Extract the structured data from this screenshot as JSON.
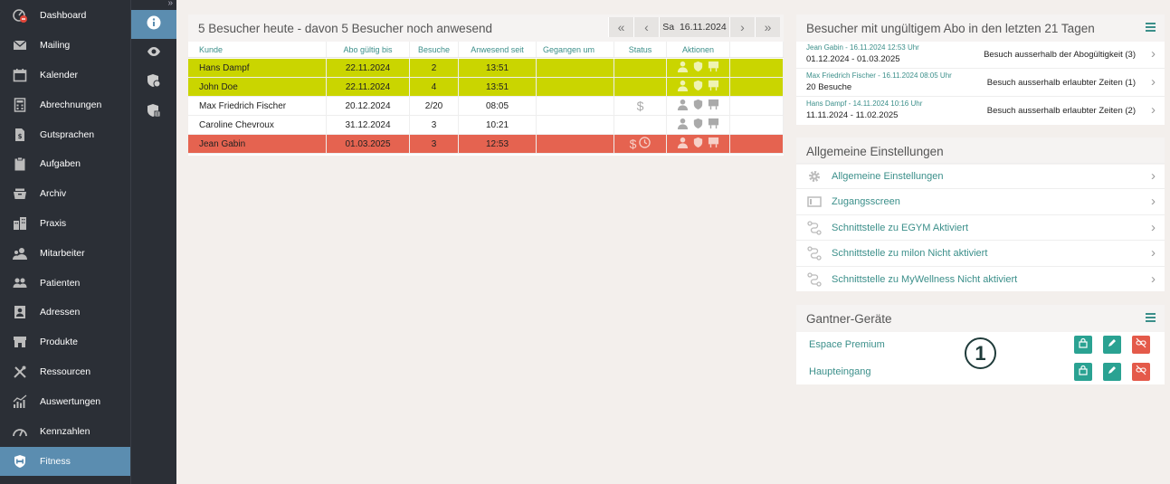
{
  "sidebar": {
    "items": [
      {
        "label": "Dashboard",
        "icon": "dashboard-icon"
      },
      {
        "label": "Mailing",
        "icon": "mail-icon"
      },
      {
        "label": "Kalender",
        "icon": "calendar-icon"
      },
      {
        "label": "Abrechnungen",
        "icon": "calculator-icon"
      },
      {
        "label": "Gutsprachen",
        "icon": "document-icon"
      },
      {
        "label": "Aufgaben",
        "icon": "clipboard-icon"
      },
      {
        "label": "Archiv",
        "icon": "archive-icon"
      },
      {
        "label": "Praxis",
        "icon": "building-icon"
      },
      {
        "label": "Mitarbeiter",
        "icon": "staff-icon"
      },
      {
        "label": "Patienten",
        "icon": "patients-icon"
      },
      {
        "label": "Adressen",
        "icon": "address-book-icon"
      },
      {
        "label": "Produkte",
        "icon": "shop-icon"
      },
      {
        "label": "Ressourcen",
        "icon": "tools-icon"
      },
      {
        "label": "Auswertungen",
        "icon": "chart-icon"
      },
      {
        "label": "Kennzahlen",
        "icon": "gauge-icon"
      },
      {
        "label": "Fitness",
        "icon": "fitness-icon"
      }
    ],
    "active": "Fitness"
  },
  "iconbar": {
    "expand": "»",
    "items": [
      "info-icon",
      "eye-icon",
      "shield-icon",
      "shield-list-icon"
    ]
  },
  "visitors": {
    "title": "5 Besucher heute - davon 5 Besucher noch anwesend",
    "date_day": "Sa",
    "date": "16.11.2024",
    "nav": {
      "first": "«",
      "prev": "‹",
      "next": "›",
      "last": "»"
    },
    "columns": [
      "Kunde",
      "Abo gültig bis",
      "Besuche",
      "Anwesend seit",
      "Gegangen um",
      "Status",
      "Aktionen"
    ],
    "rows": [
      {
        "kunde": "Hans Dampf",
        "abo": "22.11.2024",
        "besuche": "2",
        "anwesend": "13:51",
        "gegangen": "",
        "status": "",
        "style": "yellow"
      },
      {
        "kunde": "John Doe",
        "abo": "22.11.2024",
        "besuche": "4",
        "anwesend": "13:51",
        "gegangen": "",
        "status": "",
        "style": "yellow"
      },
      {
        "kunde": "Max Friedrich Fischer",
        "abo": "20.12.2024",
        "besuche": "2/20",
        "anwesend": "08:05",
        "gegangen": "",
        "status": "$",
        "style": "white"
      },
      {
        "kunde": "Caroline Chevroux",
        "abo": "31.12.2024",
        "besuche": "3",
        "anwesend": "10:21",
        "gegangen": "",
        "status": "",
        "style": "white"
      },
      {
        "kunde": "Jean Gabin",
        "abo": "01.03.2025",
        "besuche": "3",
        "anwesend": "12:53",
        "gegangen": "",
        "status": "$",
        "style": "red"
      }
    ]
  },
  "invalid": {
    "title": "Besucher mit ungültigem Abo in den letzten 21 Tagen",
    "items": [
      {
        "header": "Jean Gabin - 16.11.2024 12:53 Uhr",
        "detail": "01.12.2024 - 01.03.2025",
        "reason": "Besuch ausserhalb der Abogültigkeit (3)"
      },
      {
        "header": "Max Friedrich Fischer - 16.11.2024 08:05 Uhr",
        "detail": "20 Besuche",
        "reason": "Besuch ausserhalb erlaubter Zeiten (1)"
      },
      {
        "header": "Hans Dampf - 14.11.2024 10:16 Uhr",
        "detail": "11.11.2024 - 11.02.2025",
        "reason": "Besuch ausserhalb erlaubter Zeiten (2)"
      }
    ]
  },
  "settings": {
    "title": "Allgemeine Einstellungen",
    "items": [
      {
        "label": "Allgemeine Einstellungen",
        "icon": "gear-icon"
      },
      {
        "label": "Zugangsscreen",
        "icon": "screen-icon"
      },
      {
        "label": "Schnittstelle zu EGYM Aktiviert",
        "icon": "connection-icon"
      },
      {
        "label": "Schnittstelle zu milon Nicht aktiviert",
        "icon": "connection-icon"
      },
      {
        "label": "Schnittstelle zu MyWellness Nicht aktiviert",
        "icon": "connection-icon"
      }
    ]
  },
  "gantner": {
    "title": "Gantner-Geräte",
    "devices": [
      {
        "label": "Espace Premium"
      },
      {
        "label": "Haupteingang"
      }
    ]
  },
  "callout": "1",
  "chevron": "›",
  "colors": {
    "accent": "#3b8f8a",
    "active_nav": "#5b8db0",
    "row_yellow": "#cad500",
    "row_red": "#e56350",
    "button_teal": "#2aa292",
    "button_coral": "#e45a4a"
  }
}
